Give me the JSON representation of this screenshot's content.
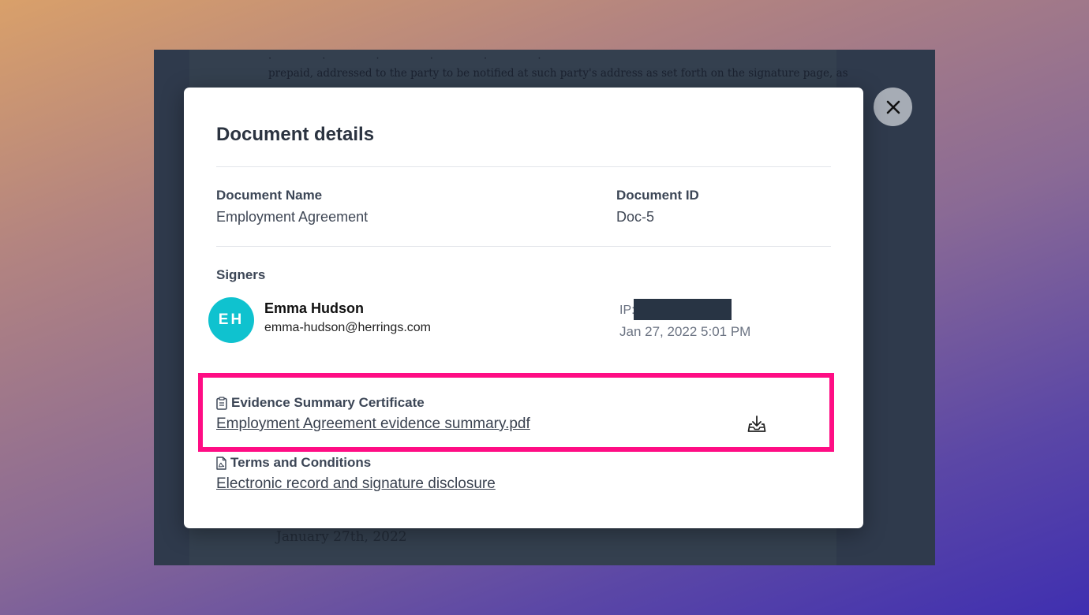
{
  "background_document": {
    "top_line": "· · · · · ·",
    "line": "prepaid, addressed to the party to be notified at such party's address as set forth on the signature page, as",
    "date": "January 27th, 2022"
  },
  "modal": {
    "title": "Document details",
    "document_name_label": "Document Name",
    "document_name_value": "Employment Agreement",
    "document_id_label": "Document ID",
    "document_id_value": "Doc-5",
    "signers_label": "Signers",
    "signer": {
      "initials": "EH",
      "name": "Emma Hudson",
      "email": "emma-hudson@herrings.com",
      "ip_label": "IP:",
      "signed_at": "Jan 27, 2022 5:01 PM"
    },
    "evidence": {
      "title": "Evidence Summary Certificate",
      "link": "Employment Agreement evidence summary.pdf",
      "icon": "clipboard-icon"
    },
    "terms": {
      "title": "Terms and Conditions",
      "link": "Electronic record and signature disclosure",
      "icon": "pdf-file-icon"
    },
    "download_icon": "download-tray-icon",
    "close_icon": "close-icon"
  },
  "colors": {
    "highlight": "#ff0d84",
    "avatar": "#0fc2cf",
    "overlay": "#2f3a4c"
  }
}
